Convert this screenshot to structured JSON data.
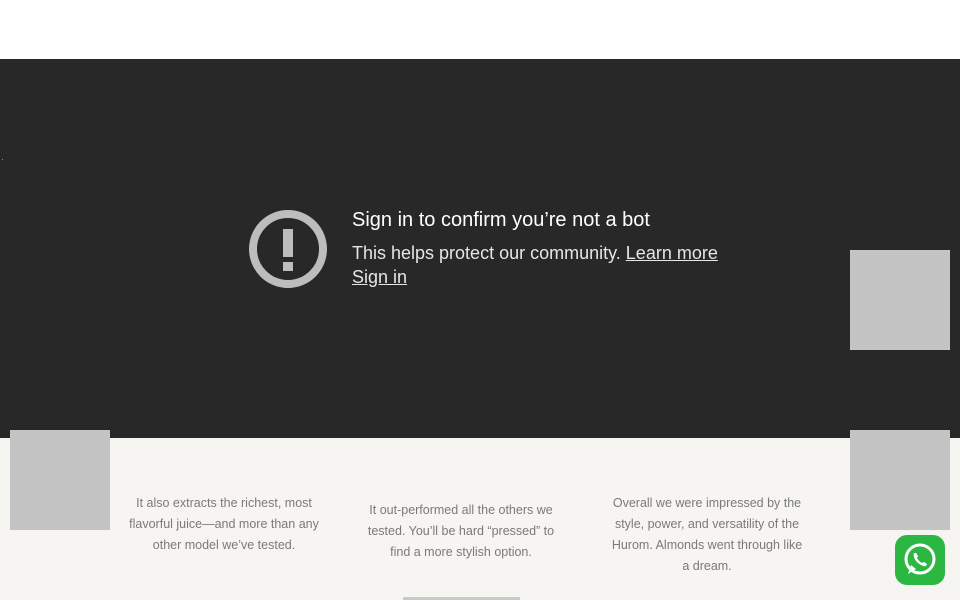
{
  "video_notice": {
    "title": "Sign in to confirm you’re not a bot",
    "body": "This helps protect our community.",
    "learn_more": "Learn more",
    "sign_in": "Sign in",
    "icon": "exclamation-circle-icon"
  },
  "testimonials": [
    {
      "text": "It also extracts the richest, most flavorful juice—and more than any other model we’ve tested."
    },
    {
      "text": "It out-performed all the others we tested. You’ll be hard “pressed” to find a more stylish option."
    },
    {
      "text": "Overall we were impressed by the style, power, and versatility of the Hurom. Almonds went through like a dream."
    }
  ],
  "whatsapp": {
    "icon": "whatsapp-icon",
    "color": "#2bb741"
  },
  "colors": {
    "video_bg": "#282828",
    "placeholder": "#c4c4c4",
    "section_bg": "#f7f5f2"
  }
}
